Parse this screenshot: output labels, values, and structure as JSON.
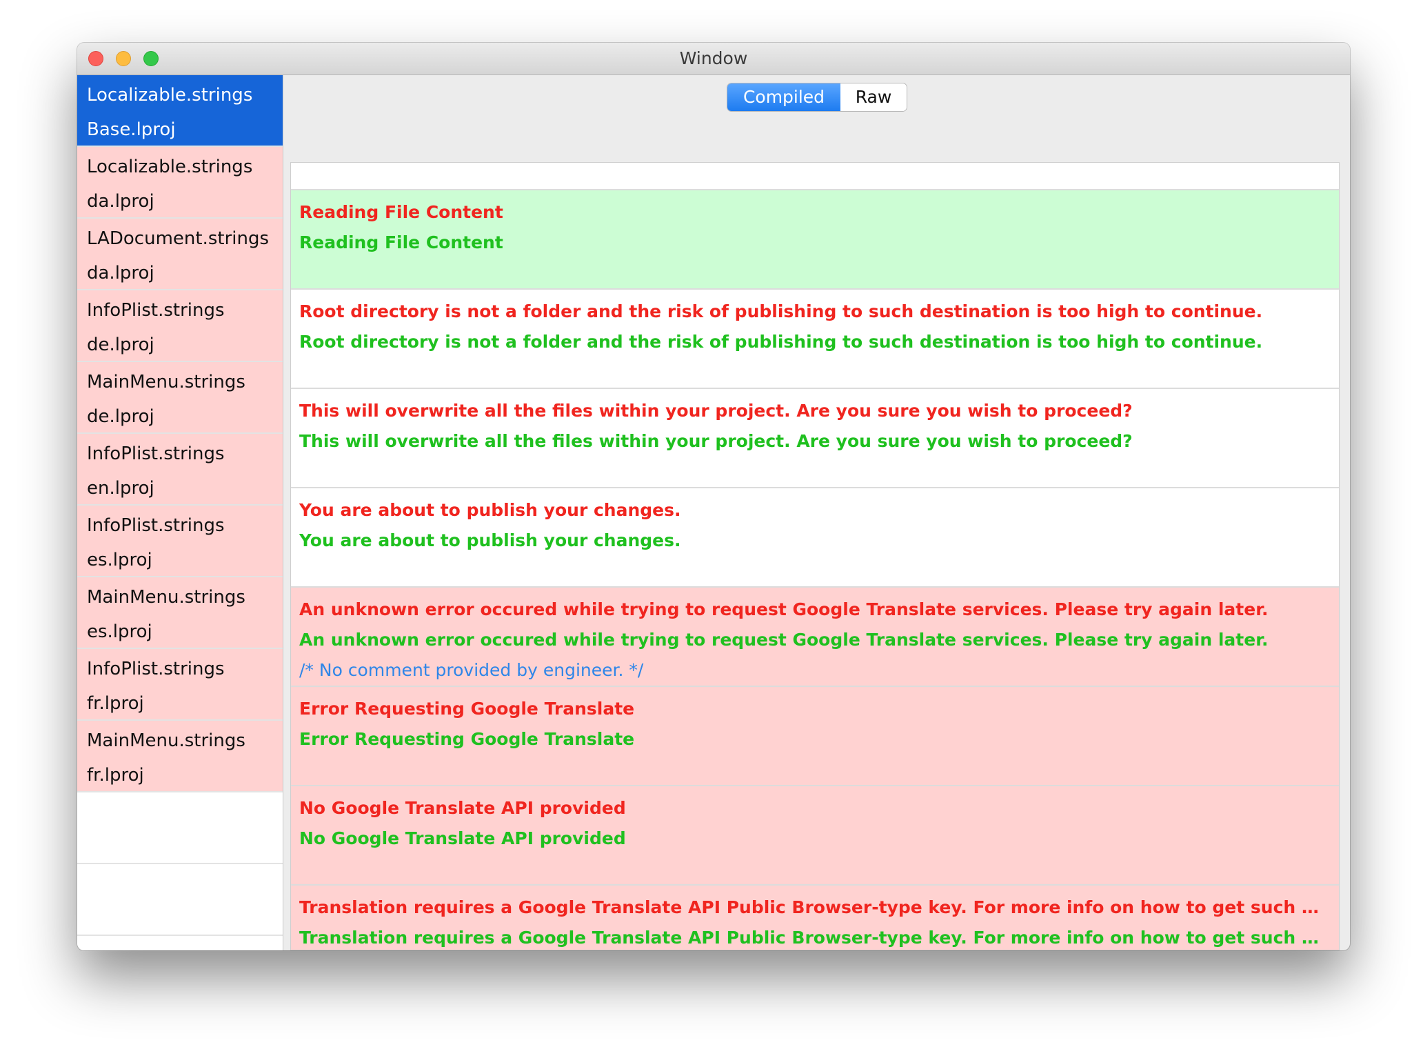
{
  "window": {
    "title": "Window"
  },
  "sidebar": {
    "items": [
      {
        "name": "Localizable.strings",
        "folder": "Base.lproj",
        "state": "selected"
      },
      {
        "name": "Localizable.strings",
        "folder": "da.lproj",
        "state": "error"
      },
      {
        "name": "LADocument.strings",
        "folder": "da.lproj",
        "state": "error"
      },
      {
        "name": "InfoPlist.strings",
        "folder": "de.lproj",
        "state": "error"
      },
      {
        "name": "MainMenu.strings",
        "folder": "de.lproj",
        "state": "error"
      },
      {
        "name": "InfoPlist.strings",
        "folder": "en.lproj",
        "state": "error"
      },
      {
        "name": "InfoPlist.strings",
        "folder": "es.lproj",
        "state": "error"
      },
      {
        "name": "MainMenu.strings",
        "folder": "es.lproj",
        "state": "error"
      },
      {
        "name": "InfoPlist.strings",
        "folder": "fr.lproj",
        "state": "error"
      },
      {
        "name": "MainMenu.strings",
        "folder": "fr.lproj",
        "state": "error"
      }
    ]
  },
  "segmented": {
    "compiled_label": "Compiled",
    "raw_label": "Raw",
    "selected": "Compiled"
  },
  "entries": [
    {
      "key": "Reading File Content",
      "value": "Reading File Content",
      "comment": "",
      "state": "ok"
    },
    {
      "key": "Root directory is not a folder and the risk of publishing to such destination is too high to continue.",
      "value": "Root directory is not a folder and the risk of publishing to such destination is too high to continue.",
      "comment": "",
      "state": "none"
    },
    {
      "key": "This will overwrite all the files within your project. Are you sure you wish to proceed?",
      "value": "This will overwrite all the files within your project. Are you sure you wish to proceed?",
      "comment": "",
      "state": "none"
    },
    {
      "key": "You are about to publish your changes.",
      "value": "You are about to publish your changes.",
      "comment": "",
      "state": "none"
    },
    {
      "key": "An unknown error occured while trying to request Google Translate services. Please try again later.",
      "value": "An unknown error occured while trying to request Google Translate services. Please try again later.",
      "comment": "/* No comment provided by engineer. */",
      "state": "err"
    },
    {
      "key": "Error Requesting Google Translate",
      "value": "Error Requesting Google Translate",
      "comment": "",
      "state": "err"
    },
    {
      "key": "No Google Translate API provided",
      "value": "No Google Translate API provided",
      "comment": "",
      "state": "err"
    },
    {
      "key": "Translation requires a Google Translate API Public Browser-type key. For more info on how to get such key, please...",
      "value": "Translation requires a Google Translate API Public Browser-type key. For more info on how to get such key, please vi...",
      "comment": "",
      "state": "err"
    }
  ],
  "colors": {
    "selection": "#1665d8",
    "missing": "#ffd2d1",
    "translated": "#ccfdd4",
    "key_text": "#f0251f",
    "value_text": "#1fc01f",
    "comment_text": "#2f86e8"
  }
}
